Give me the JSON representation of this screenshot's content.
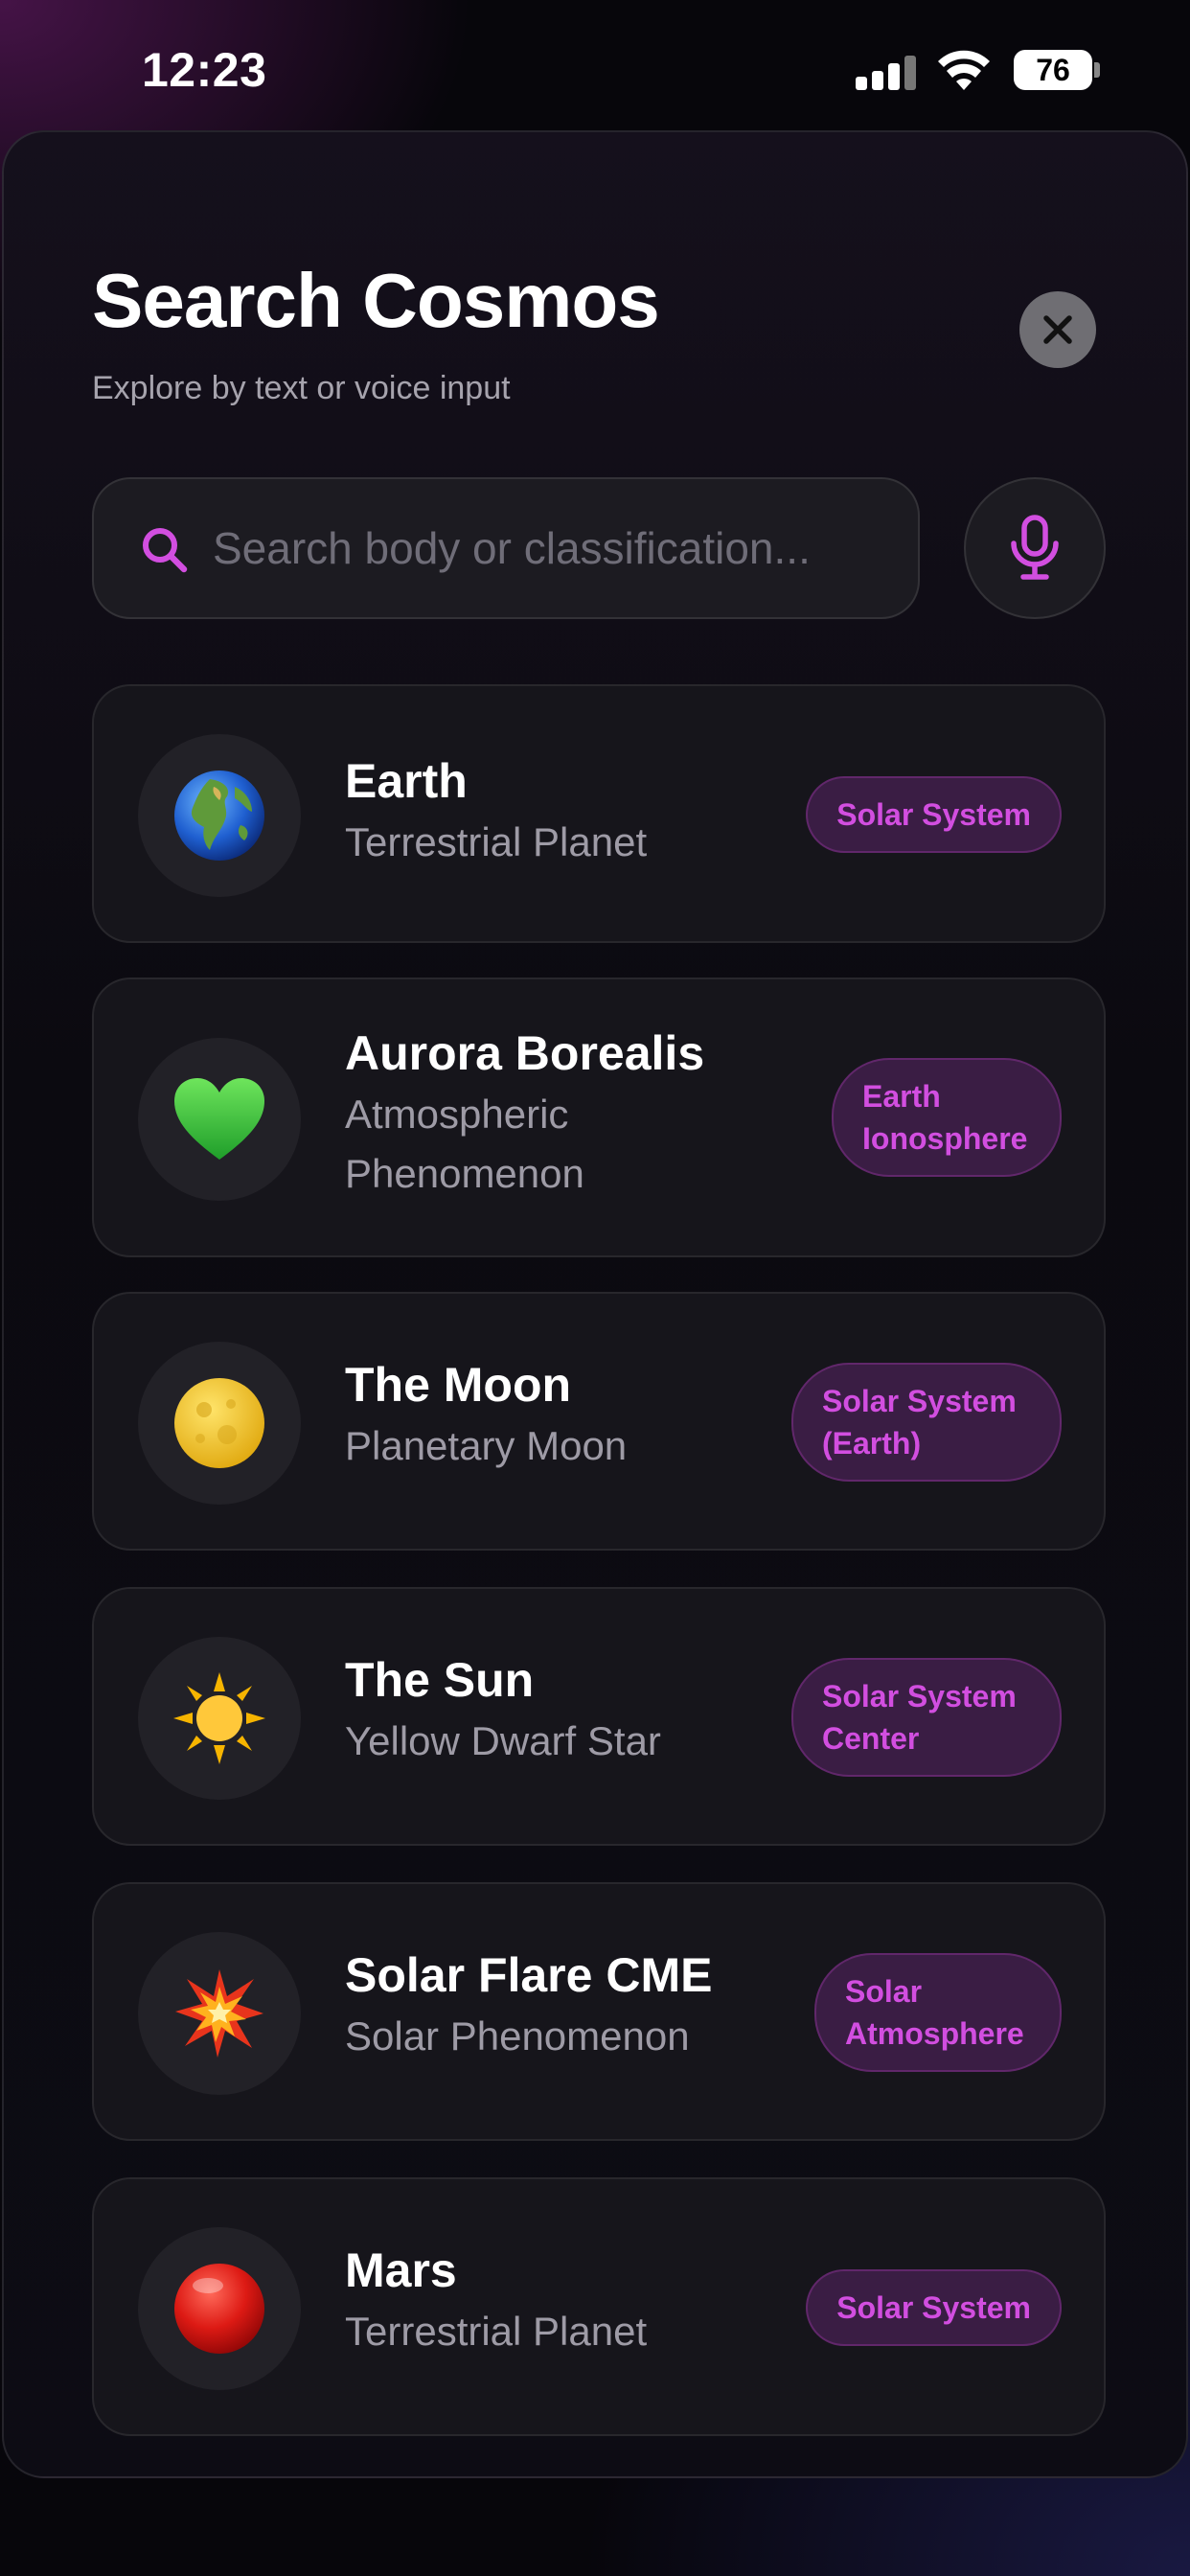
{
  "status_bar": {
    "time": "12:23",
    "battery": "76"
  },
  "header": {
    "title": "Search Cosmos",
    "subtitle": "Explore by text or voice input"
  },
  "search": {
    "placeholder": "Search body or classification...",
    "value": ""
  },
  "icons": {
    "search": "search-icon",
    "mic": "microphone-icon",
    "close": "close-icon"
  },
  "colors": {
    "accent": "#d24ee0",
    "badge_bg": "#3a1d44",
    "card_bg": "#16151b"
  },
  "results": [
    {
      "emoji": "🌍",
      "name": "Earth",
      "type": "Terrestrial Planet",
      "badge": "Solar System"
    },
    {
      "emoji": "💚",
      "name": "Aurora Borealis",
      "type": "Atmospheric Phenomenon",
      "badge": "Earth Ionosphere"
    },
    {
      "emoji": "🌕",
      "name": "The Moon",
      "type": "Planetary Moon",
      "badge": "Solar System (Earth)"
    },
    {
      "emoji": "☀️",
      "name": "The Sun",
      "type": "Yellow Dwarf Star",
      "badge": "Solar System Center"
    },
    {
      "emoji": "💥",
      "name": "Solar Flare CME",
      "type": "Solar Phenomenon",
      "badge": "Solar Atmosphere"
    },
    {
      "emoji": "🔴",
      "name": "Mars",
      "type": "Terrestrial Planet",
      "badge": "Solar System"
    }
  ]
}
